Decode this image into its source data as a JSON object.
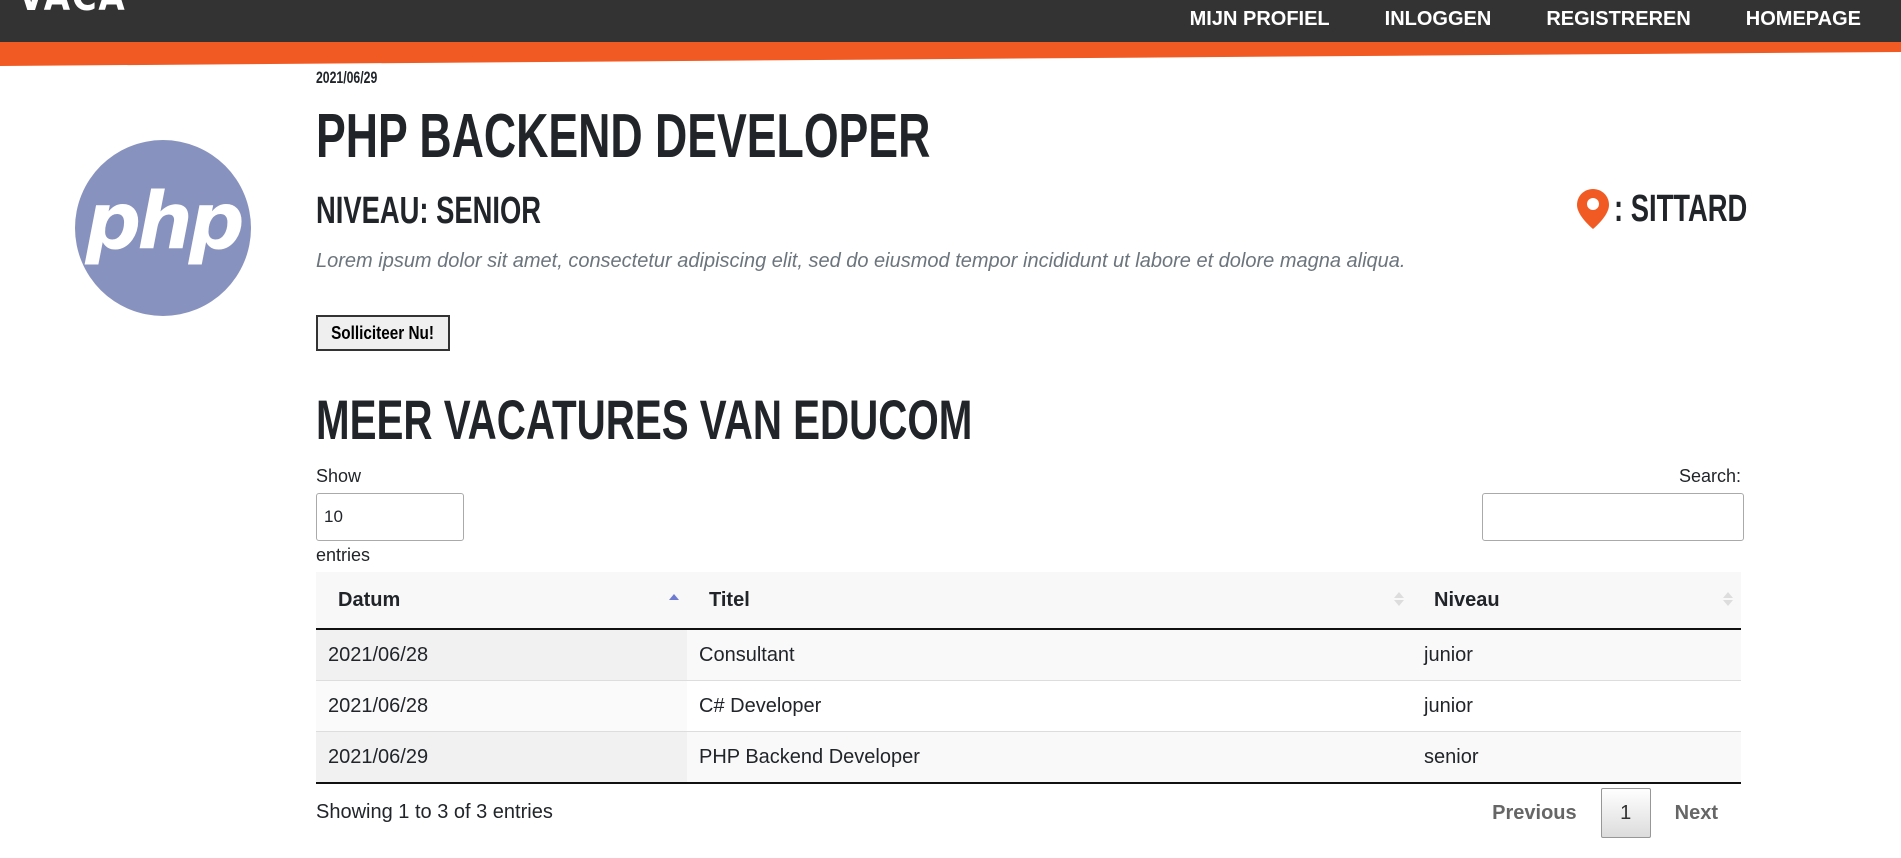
{
  "header": {
    "logo_text": "VACA",
    "nav": [
      "MIJN PROFIEL",
      "INLOGGEN",
      "REGISTREREN",
      "HOMEPAGE"
    ]
  },
  "vacancy": {
    "date": "2021/06/29",
    "title": "PHP BACKEND DEVELOPER",
    "level": "NIVEAU: SENIOR",
    "location": ": SITTARD",
    "description": "Lorem ipsum dolor sit amet, consectetur adipiscing elit, sed do eiusmod tempor incididunt ut labore et dolore magna aliqua.",
    "apply_label": "Solliciteer Nu!",
    "logo_text": "php"
  },
  "more": {
    "title": "MEER VACATURES VAN EDUCOM"
  },
  "datatable": {
    "show_label": "Show",
    "length_value": "10",
    "entries_label": "entries",
    "search_label": "Search:",
    "search_value": "",
    "columns": [
      "Datum",
      "Titel",
      "Niveau"
    ],
    "rows": [
      [
        "2021/06/28",
        "Consultant",
        "junior"
      ],
      [
        "2021/06/28",
        "C# Developer",
        "junior"
      ],
      [
        "2021/06/29",
        "PHP Backend Developer",
        "senior"
      ]
    ],
    "info": "Showing 1 to 3 of 3 entries",
    "prev_label": "Previous",
    "current_page": "1",
    "next_label": "Next"
  },
  "colors": {
    "header_bg": "#333333",
    "accent": "#f15a22",
    "php_logo": "#8892bf",
    "sort_active": "#6f7bd1"
  }
}
